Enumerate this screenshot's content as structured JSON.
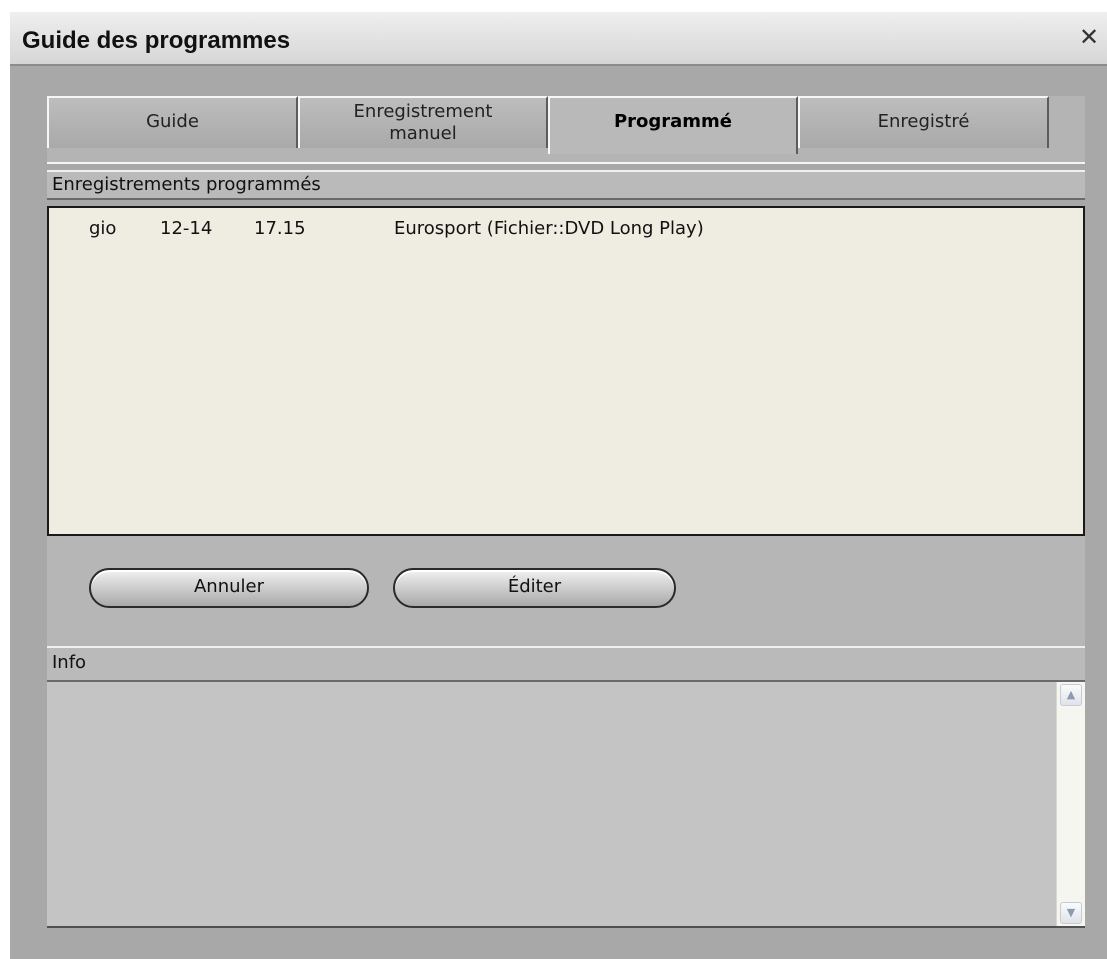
{
  "window": {
    "title": "Guide des programmes",
    "close_icon": "close-icon"
  },
  "tabs": [
    {
      "label": "Guide",
      "active": false
    },
    {
      "label_line1": "Enregistrement",
      "label_line2": "manuel",
      "active": false
    },
    {
      "label": "Programmé",
      "active": true
    },
    {
      "label": "Enregistré",
      "active": false
    }
  ],
  "scheduled": {
    "header": "Enregistrements programmés",
    "rows": [
      {
        "day": "gio",
        "date": "12-14",
        "time": "17.15",
        "description": "Eurosport (Fichier::DVD Long Play)"
      }
    ]
  },
  "buttons": {
    "cancel": "Annuler",
    "edit": "Éditer"
  },
  "info": {
    "header": "Info",
    "text": ""
  },
  "icons": {
    "scroll_up": "chevron-up-icon",
    "scroll_down": "chevron-down-icon"
  },
  "colors": {
    "list_background": "#efece1",
    "window_background": "#a8a8a8"
  }
}
